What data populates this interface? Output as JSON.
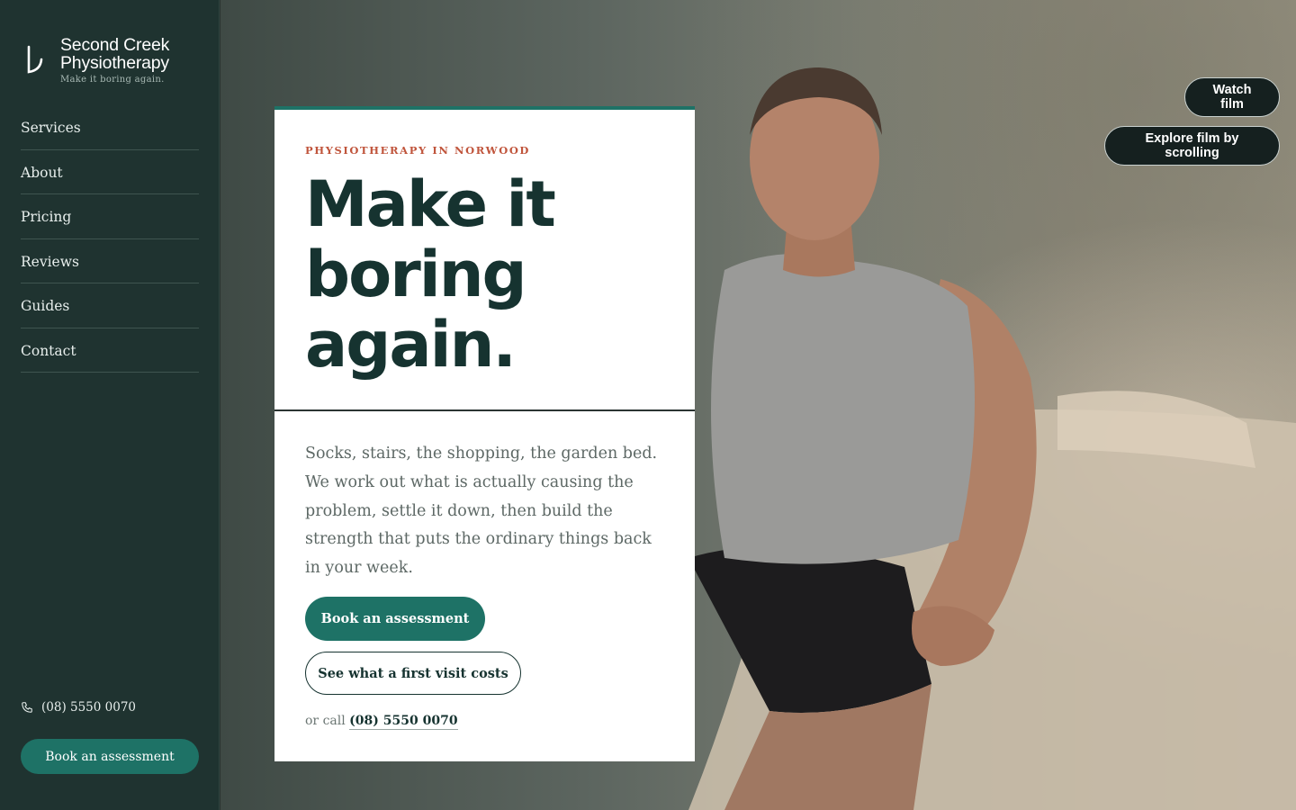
{
  "brand": {
    "name_line1": "Second Creek",
    "name_line2": "Physiotherapy",
    "tagline": "Make it boring again."
  },
  "nav": {
    "items": [
      {
        "label": "Services"
      },
      {
        "label": "About"
      },
      {
        "label": "Pricing"
      },
      {
        "label": "Reviews"
      },
      {
        "label": "Guides"
      },
      {
        "label": "Contact"
      }
    ]
  },
  "sidebar_footer": {
    "phone": "(08) 5550 0070",
    "cta_label": "Book an assessment"
  },
  "hero": {
    "eyebrow": "PHYSIOTHERAPY IN NORWOOD",
    "headline_line1": "Make it",
    "headline_line2": "boring",
    "headline_line3": "again.",
    "lede": "Socks, stairs, the shopping, the garden bed. We work out what is actually causing the problem, settle it down, then build the strength that puts the ordinary things back in your week.",
    "primary_cta": "Book an assessment",
    "secondary_cta": "See what a first visit costs",
    "or_call_prefix": "or call",
    "or_call_phone": "(08) 5550 0070"
  },
  "film": {
    "watch_label": "Watch film",
    "explore_label": "Explore film by scrolling"
  },
  "colors": {
    "sidebar_bg": "#1f3330",
    "accent_teal": "#1e7266",
    "headline_dark": "#163330",
    "eyebrow_rust": "#c0553c"
  },
  "icons": {
    "logo": "second-creek-logo-mark",
    "phone": "phone-icon"
  }
}
